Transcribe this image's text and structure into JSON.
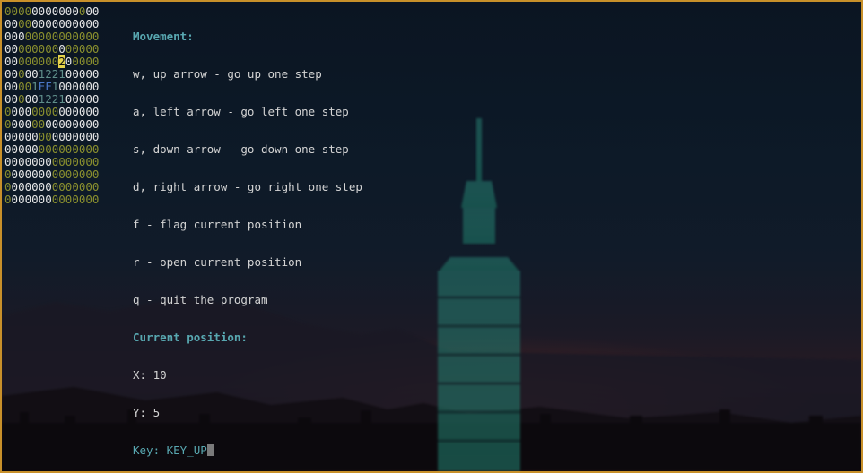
{
  "colors": {
    "window_border": "#c8902a",
    "heading": "#58a7b0",
    "text": "#d4d4d4",
    "grid_bright": "#e6e6e6",
    "grid_dim": "#8a8f2e",
    "grid_number": "#5f8e8a",
    "grid_flag": "#4a78c8",
    "grid_cursor": "#e6d34a"
  },
  "grid": {
    "rows": [
      "00000000000000",
      "00000000000000",
      "00000000000000",
      "00000000000000",
      "00000000200000",
      "00000122100000",
      "00001FF1000000",
      "00000122100000",
      "00000000000000",
      "00000000000000",
      "00000000000000",
      "00000000000000",
      "00000000000000",
      "00000000000000",
      "00000000000000",
      "00000000000000"
    ],
    "cursor": {
      "row": 4,
      "col": 8
    }
  },
  "info": {
    "movement_heading": "Movement:",
    "controls": [
      "w, up arrow - go up one step",
      "a, left arrow - go left one step",
      "s, down arrow - go down one step",
      "d, right arrow - go right one step",
      "f - flag current position",
      "r - open current position",
      "q - quit the program"
    ],
    "position_heading": "Current position:",
    "x_line": "X: 10",
    "y_line": "Y: 5",
    "key_line": "Key: KEY_UP"
  }
}
